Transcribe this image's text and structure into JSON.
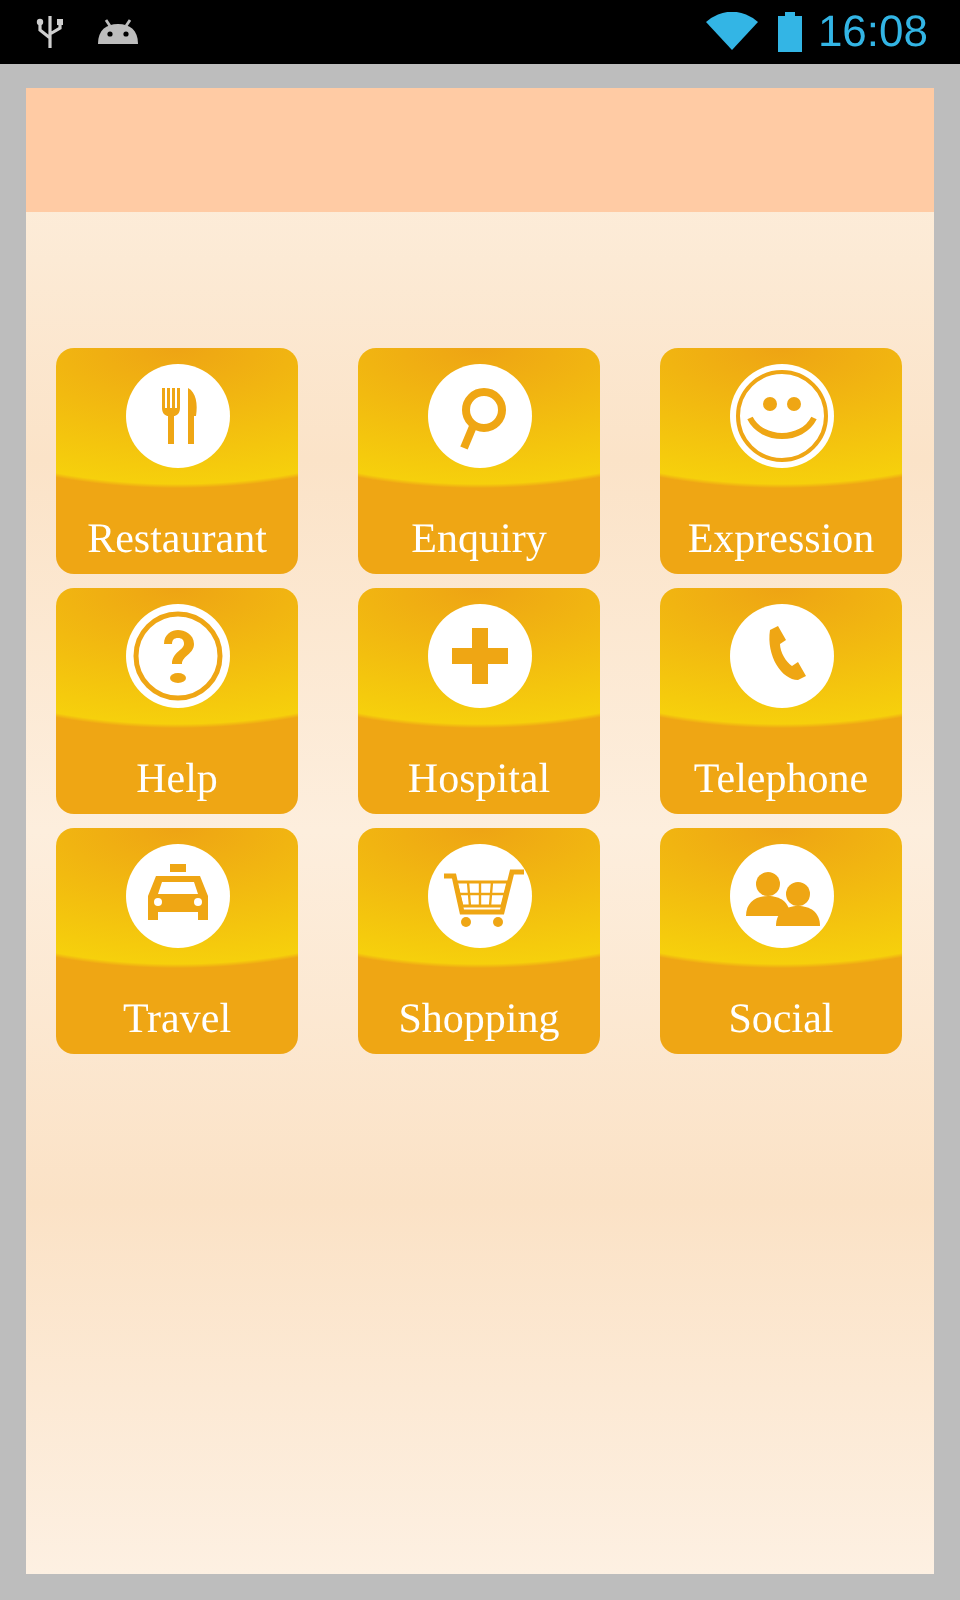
{
  "status_bar": {
    "time": "16:08"
  },
  "tiles": [
    {
      "label": "Restaurant",
      "kind": "restaurant"
    },
    {
      "label": "Enquiry",
      "kind": "enquiry"
    },
    {
      "label": "Expression",
      "kind": "expression"
    },
    {
      "label": "Help",
      "kind": "help"
    },
    {
      "label": "Hospital",
      "kind": "hospital"
    },
    {
      "label": "Telephone",
      "kind": "telephone"
    },
    {
      "label": "Travel",
      "kind": "travel"
    },
    {
      "label": "Shopping",
      "kind": "shopping"
    },
    {
      "label": "Social",
      "kind": "social"
    }
  ]
}
